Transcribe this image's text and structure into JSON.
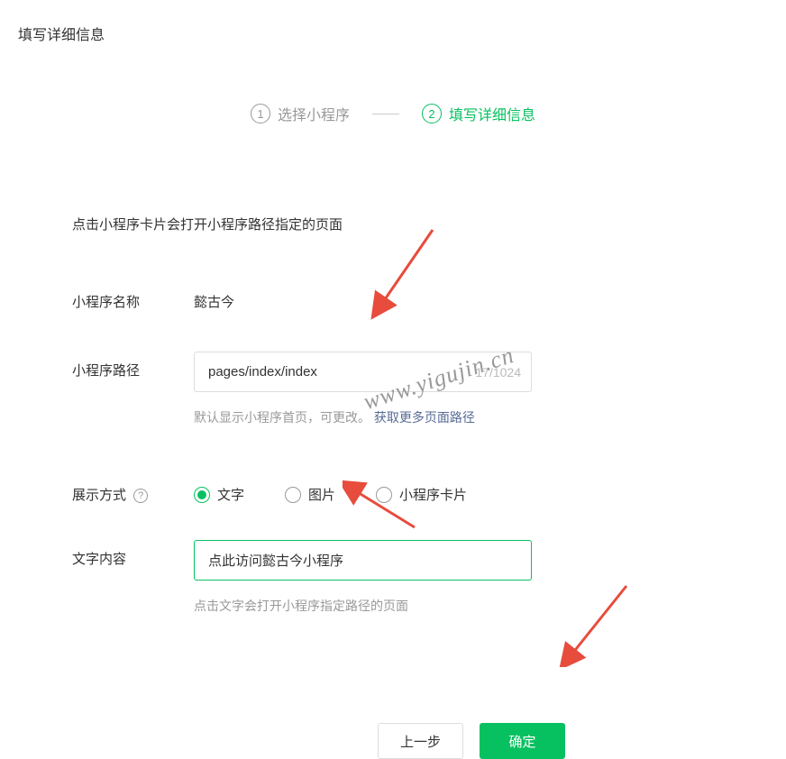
{
  "pageTitle": "填写详细信息",
  "steps": {
    "step1": {
      "number": "①",
      "label": "选择小程序",
      "numText": "1"
    },
    "step2": {
      "number": "②",
      "label": "填写详细信息",
      "numText": "2"
    }
  },
  "description": "点击小程序卡片会打开小程序路径指定的页面",
  "appName": {
    "label": "小程序名称",
    "value": "懿古今"
  },
  "appPath": {
    "label": "小程序路径",
    "value": "pages/index/index",
    "charCount": "17/1024",
    "hint": "默认显示小程序首页，可更改。",
    "link": "获取更多页面路径"
  },
  "displayMode": {
    "label": "展示方式",
    "options": {
      "text": "文字",
      "image": "图片",
      "card": "小程序卡片"
    }
  },
  "textContent": {
    "label": "文字内容",
    "value": "点此访问懿古今小程序",
    "hint": "点击文字会打开小程序指定路径的页面"
  },
  "buttons": {
    "prev": "上一步",
    "confirm": "确定"
  },
  "watermark": "www.yigujin.cn"
}
